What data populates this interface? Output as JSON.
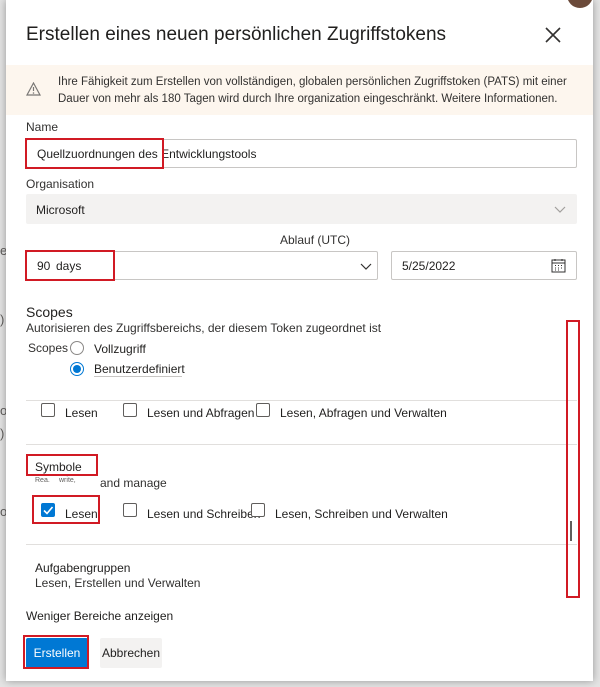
{
  "background": {
    "fragments": [
      "e",
      ")",
      "o",
      ")",
      "o"
    ]
  },
  "dialog": {
    "title": "Erstellen eines neuen persönlichen Zugriffstokens",
    "warning": {
      "text": "Ihre Fähigkeit zum Erstellen von vollständigen, globalen persönlichen Zugriffstoken (PATS) mit einer Dauer von mehr als 180 Tagen wird durch Ihre organization eingeschränkt.",
      "link": "Weitere Informationen."
    },
    "name": {
      "label": "Name",
      "value": "Quellzuordnungen des Entwicklungstools"
    },
    "organization": {
      "label": "Organisation",
      "value": "Microsoft"
    },
    "expiration": {
      "label": "Ablauf (UTC)",
      "duration_number": "90",
      "duration_unit": "days",
      "date": "5/25/2022"
    },
    "scopes": {
      "title": "Scopes",
      "description": "Autorisieren des Zugriffsbereichs, der diesem Token zugeordnet ist",
      "label": "Scopes",
      "full_access": "Vollzugriff",
      "custom_defined": "Benutzerdefiniert",
      "row1": [
        "Lesen",
        "Lesen und Abfragen",
        "Lesen, Abfragen und Verwalten"
      ],
      "symbols": {
        "title": "Symbole",
        "sub_read": "Rea.",
        "sub_write": "write,",
        "sub_manage": "and manage",
        "options": [
          "Lesen",
          "Lesen und Schreiben",
          "Lesen, Schreiben und Verwalten"
        ]
      },
      "task_groups": {
        "title": "Aufgabengruppen",
        "desc": "Lesen, Erstellen und Verwalten"
      },
      "show_less": "Weniger Bereiche anzeigen"
    },
    "buttons": {
      "create": "Erstellen",
      "cancel": "Abbrechen"
    },
    "colors": {
      "accent": "#0078d4",
      "highlight": "#d11a24",
      "warning_bg": "#fdf6ee"
    }
  }
}
